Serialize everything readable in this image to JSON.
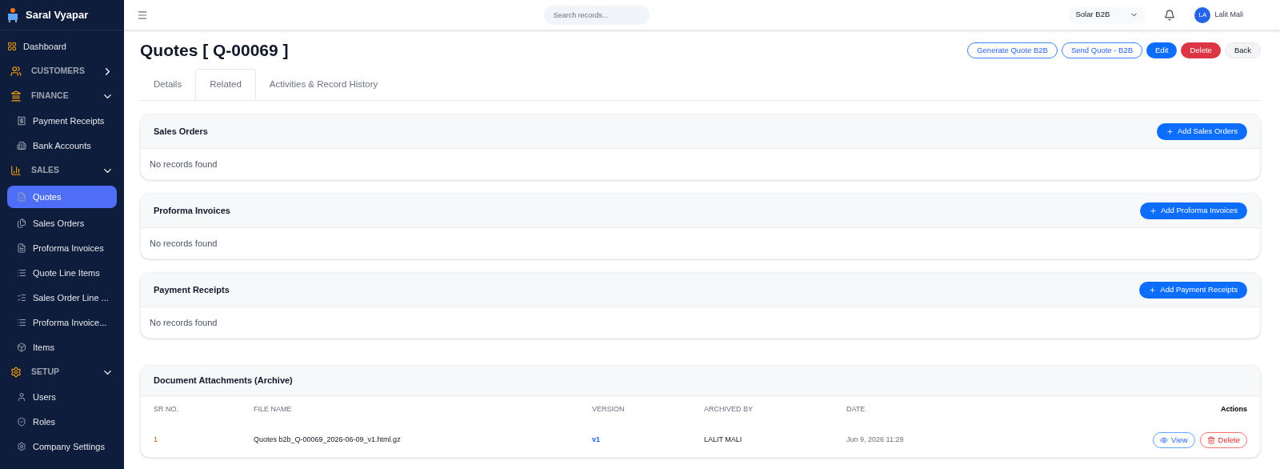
{
  "app": {
    "name": "Saral Vyapar"
  },
  "sidebar": {
    "items": [
      {
        "kind": "item",
        "label": "Dashboard",
        "selected": false
      },
      {
        "kind": "section",
        "label": "CUSTOMERS",
        "expanded": false
      },
      {
        "kind": "section",
        "label": "FINANCE",
        "expanded": true
      },
      {
        "kind": "item",
        "label": "Payment Receipts",
        "selected": false
      },
      {
        "kind": "item",
        "label": "Bank Accounts",
        "selected": false
      },
      {
        "kind": "section",
        "label": "SALES",
        "expanded": true
      },
      {
        "kind": "item",
        "label": "Quotes",
        "selected": true
      },
      {
        "kind": "item",
        "label": "Sales Orders",
        "selected": false
      },
      {
        "kind": "item",
        "label": "Proforma Invoices",
        "selected": false
      },
      {
        "kind": "item",
        "label": "Quote Line Items",
        "selected": false
      },
      {
        "kind": "item",
        "label": "Sales Order Line ...",
        "selected": false
      },
      {
        "kind": "item",
        "label": "Proforma Invoice...",
        "selected": false
      },
      {
        "kind": "item",
        "label": "Items",
        "selected": false
      },
      {
        "kind": "section",
        "label": "SETUP",
        "expanded": true
      },
      {
        "kind": "item",
        "label": "Users",
        "selected": false
      },
      {
        "kind": "item",
        "label": "Roles",
        "selected": false
      },
      {
        "kind": "item",
        "label": "Company Settings",
        "selected": false
      }
    ]
  },
  "topbar": {
    "search": {
      "placeholder": "Search records..."
    },
    "company": "Solar B2B",
    "user": {
      "initials": "LA",
      "name": "Lalit Mali"
    }
  },
  "page": {
    "title": "Quotes [ Q-00069 ]",
    "actions": [
      {
        "kind": "outline",
        "label": "Generate Quote B2B"
      },
      {
        "kind": "outline",
        "label": "Send Quote - B2B"
      },
      {
        "kind": "primary",
        "label": "Edit"
      },
      {
        "kind": "danger",
        "label": "Delete"
      },
      {
        "kind": "light",
        "label": "Back"
      }
    ],
    "tabs": [
      {
        "label": "Details",
        "selected": false
      },
      {
        "label": "Related",
        "selected": true
      },
      {
        "label": "Activities & Record History",
        "selected": false
      }
    ]
  },
  "related": [
    {
      "title": "Sales Orders",
      "add": "Add Sales Orders",
      "empty": "No records found"
    },
    {
      "title": "Proforma Invoices",
      "add": "Add Proforma Invoices",
      "empty": "No records found"
    },
    {
      "title": "Payment Receipts",
      "add": "Add Payment Receipts",
      "empty": "No records found"
    }
  ],
  "attachments": {
    "title": "Document Attachments (Archive)",
    "columns": [
      "SR NO.",
      "FILE NAME",
      "VERSION",
      "ARCHIVED BY",
      "DATE",
      "Actions"
    ],
    "rows": [
      {
        "sr": "1",
        "file": "Quotes b2b_Q-00069_2026-06-09_v1.html.gz",
        "version": "v1",
        "archived_by": "LALIT MALI",
        "date": "Jun 9, 2026 11:29",
        "view": "View",
        "delete": "Delete"
      }
    ]
  }
}
